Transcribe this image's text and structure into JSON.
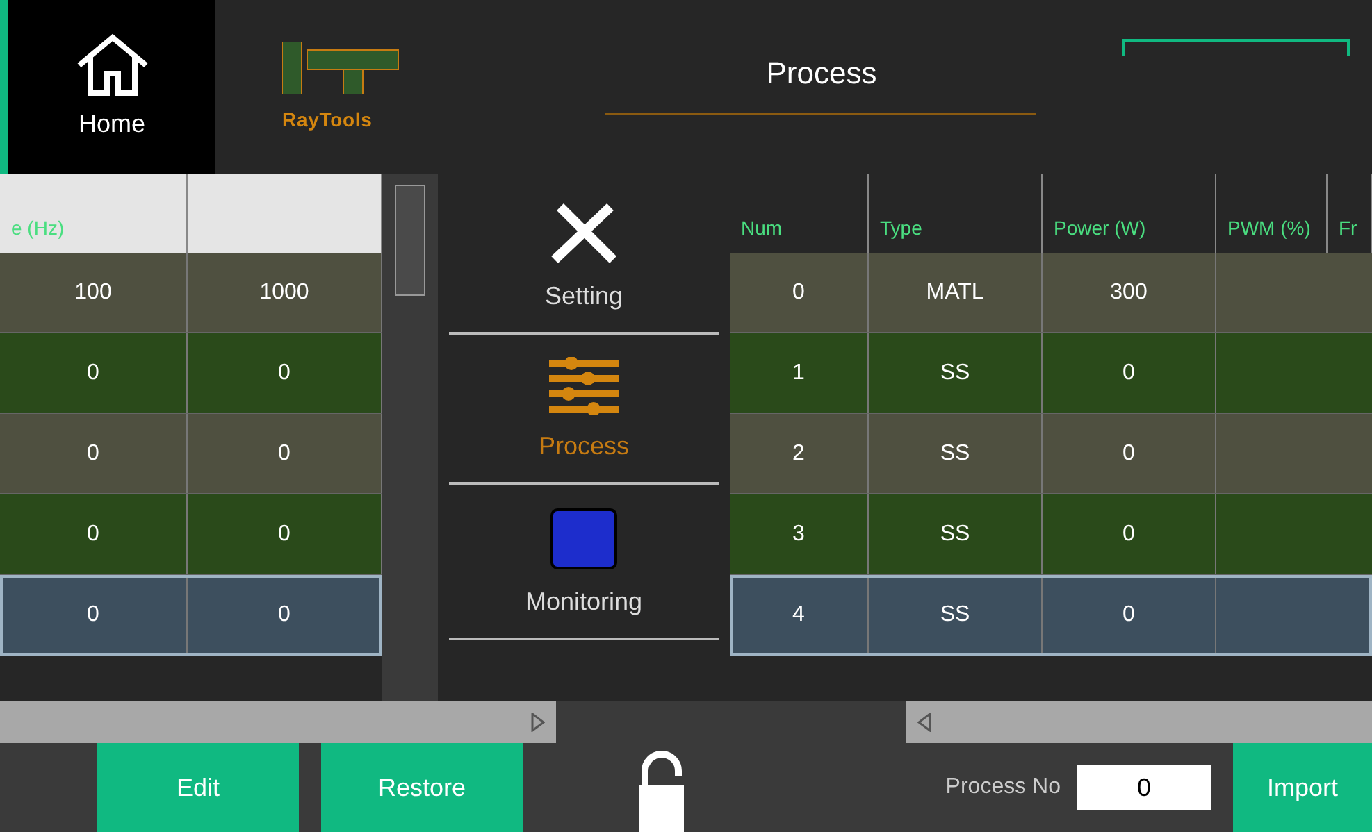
{
  "header": {
    "home": "Home",
    "logo": "RayTools",
    "title": "Process"
  },
  "left_table": {
    "columns": [
      "e (Hz)",
      ""
    ],
    "rows": [
      {
        "cells": [
          "100",
          "1000"
        ],
        "selected": false
      },
      {
        "cells": [
          "0",
          "0"
        ],
        "selected": false
      },
      {
        "cells": [
          "0",
          "0"
        ],
        "selected": false
      },
      {
        "cells": [
          "0",
          "0"
        ],
        "selected": false
      },
      {
        "cells": [
          "0",
          "0"
        ],
        "selected": true
      }
    ]
  },
  "menu": [
    {
      "label": "Setting",
      "selected": false,
      "kind": "tools"
    },
    {
      "label": "Process",
      "selected": true,
      "kind": "sliders"
    },
    {
      "label": "Monitoring",
      "selected": false,
      "kind": "monitor"
    }
  ],
  "table": {
    "columns": [
      "Num",
      "Type",
      "Power (W)",
      "PWM (%)",
      "Fr"
    ],
    "rows": [
      {
        "cells": [
          "0",
          "MATL",
          "300"
        ],
        "selected": false
      },
      {
        "cells": [
          "1",
          "SS",
          "0"
        ],
        "selected": false
      },
      {
        "cells": [
          "2",
          "SS",
          "0"
        ],
        "selected": false
      },
      {
        "cells": [
          "3",
          "SS",
          "0"
        ],
        "selected": false
      },
      {
        "cells": [
          "4",
          "SS",
          "0"
        ],
        "selected": true
      }
    ]
  },
  "buttons": [
    "Edit",
    "Restore"
  ],
  "process_no": {
    "label": "Process No",
    "value": "0"
  },
  "import_button": "Import"
}
